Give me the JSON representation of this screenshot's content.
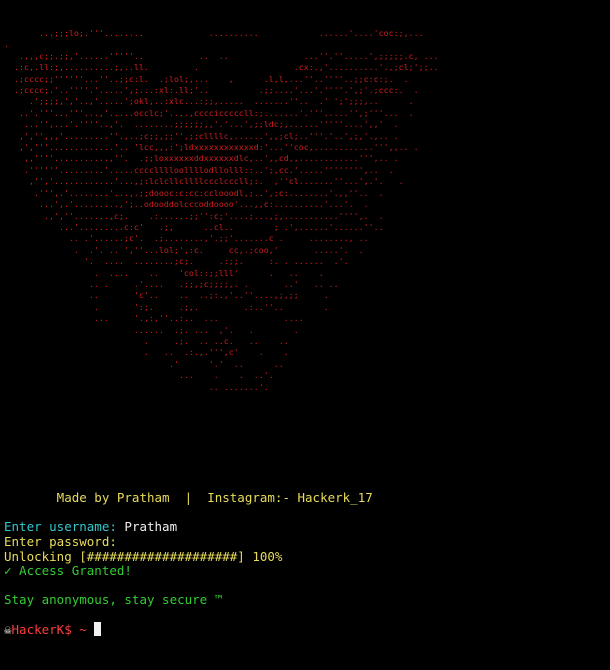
{
  "art": {
    "lines": [
      "       ...;;;lo;.'''........             ..........            ......'....'coc:;,...",
      ".",
      "   .,,,c;;.;;,'......'''''..           ..  ..               ...''.''.....',;;;;;.c, ...",
      "  .:c,.ll:;,..........;,..ll.         .                   .cx:.,'..........'.,;cl;';;..",
      "  .;cccc;;''''''...''..;;c:l.  .;lol;,...    ,      .l,l,...''..''''..;;c:c:;.  .",
      "  .;cccc;.'..''''.'.....',;...:xl:.ll;'..          .;;....'...'.''''.',;'.;ccc:.  .",
      "     .';;;;,','..,'.....';okl,..:xlc...:;;,.....  .......''..  .' ';';;;,..      .",
      "   ..'.'''...'''...,'.....occlc;'....,ccccicccccll:;.......'.'''.....'',;'''...  .",
      "    ...'',...'.''''..,'.  ........;;;;;;,,'.'...',;;ldc;,......'''''....',,'  .",
      "   ,','',,,'.........''.,..;c;;,;;'',;;cllllc,......',,;cl;..'''.'..',;,'.,.. .",
      "   ,','''.............'.. 'lcc,,,:';ldxxxxxxxxxxxxd:'...''coc,............''',,.. .",
      "    ,,''''...........,''.  .;;loxxxxxxddxxxxxxdlc,..',,cd,,............''',.. .",
      "    .''''''.........'.....cccclllloollllodllolll::..';,cc.'.....'''''''',..  .",
      "     ,'','............'...,;:lclcllcllllccclcccll;:.  ,''cl.......''...',.'.   .",
      "      .''',.'........'...,.;;doooc:c:cc:cclooodl,;..',;c:........'.,,''..  .",
      "       ...',.'.........,';..odooddolcccoddoooo'...,,c:..........'...'.  .",
      "        .,',''.......,c;.    .:......;;'':c;'....;...,;,...........'''',.  .",
      "           ...'.........c:c'   .;,      ..cl..        ; .',......'......''..",
      "             .. .'......;c'.  .;........,'.;;'.......c .     ........, ..",
      "              .  .'. .. ',''...lol;',:c.     cc,.;coo,'       .....'.  .",
      "                '.  ....  ........;c;.     .:;;.     :. . ......  .'.",
      "                  .  ....    ..    'col::;;lll'      .   ..    .",
      "                 .. .     .'....   .;;,;c;;;;,. .       ..'   .. ..",
      "                 ..       'c'..    ..  ..;:.,'..''....,;,;;     .",
      "                  .       ':;.     .;,.         .:..''..        .",
      "                  ...     '.,:,''..:..  ...             ....",
      "                          ......  .;. ...  ,'.   .        .",
      "                            .     .;.  .. ..c.   ..    ..",
      "                            .   ..  .:.,.''',c'    .    .",
      "                                 .'      '.'  ..      ..",
      "                                   ...    .    .  ..'.",
      "                                         .. .......'."
    ]
  },
  "credits": "       Made by Pratham  |  Instagram:- Hackerk_17",
  "login": {
    "username_label": "Enter username: ",
    "username_value": "Pratham",
    "password_label": "Enter password:",
    "unlocking_text": "Unlocking [####################] 100%",
    "granted_text": "✓ Access Granted!",
    "motto": "Stay anonymous, stay secure ™"
  },
  "prompt": {
    "skull": "☠",
    "text": "HackerK$ ~ "
  },
  "colors": {
    "background": "#000000",
    "art": "#d21e1e",
    "label": "#33c7cf",
    "value": "#f0f0f0",
    "credits": "#e8dc5a",
    "success": "#33cc33",
    "prompt": "#ff3b3b"
  }
}
